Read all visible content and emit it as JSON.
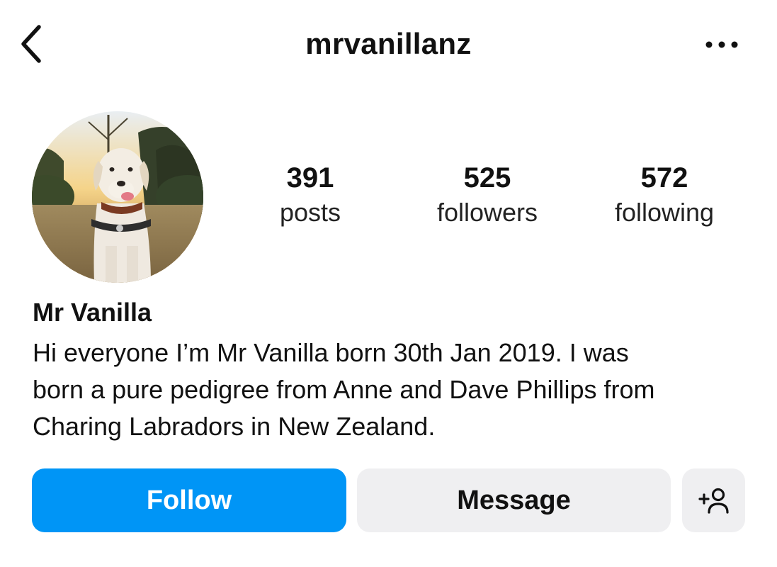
{
  "header": {
    "title": "mrvanillanz",
    "back_icon": "chevron-left-icon",
    "more_icon": "more-horizontal-icon"
  },
  "profile": {
    "avatar": "profile-photo",
    "stats": [
      {
        "value": "391",
        "label": "posts"
      },
      {
        "value": "525",
        "label": "followers"
      },
      {
        "value": "572",
        "label": "following"
      }
    ],
    "display_name": "Mr Vanilla",
    "bio_lines": [
      "Hi everyone I’m Mr Vanilla born 30th Jan 2019. I was",
      "born a pure pedigree from Anne and Dave Phillips from",
      "Charing Labradors in New Zealand."
    ]
  },
  "actions": {
    "follow_label": "Follow",
    "message_label": "Message",
    "suggest_icon": "add-person-icon"
  },
  "colors": {
    "accent": "#0095f6",
    "secondary_button": "#efeff1",
    "text": "#111111"
  }
}
